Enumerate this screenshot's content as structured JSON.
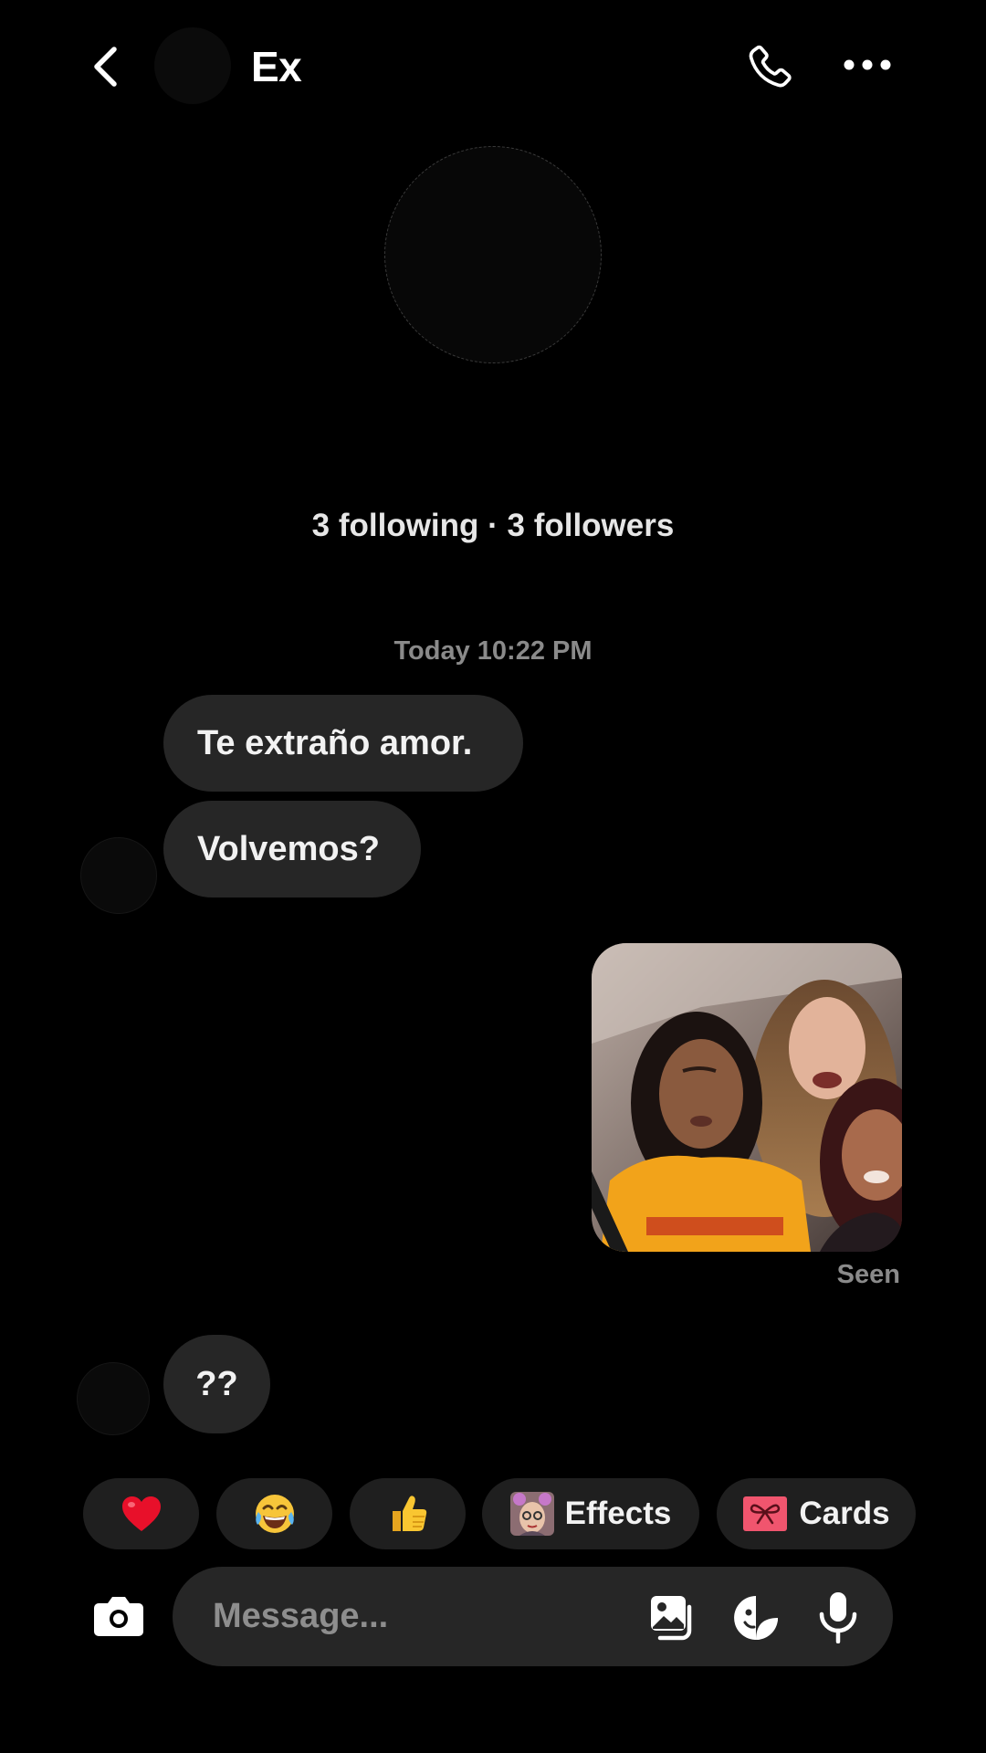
{
  "header": {
    "name": "Ex",
    "icons": {
      "back": "chevron-left-icon",
      "call": "phone-icon",
      "more": "more-horizontal-icon"
    }
  },
  "profile": {
    "stats": "3 following · 3 followers"
  },
  "thread": {
    "timestamp": "Today 10:22 PM",
    "messages": [
      {
        "from": "them",
        "text": "Te extraño amor."
      },
      {
        "from": "them",
        "text": "Volvemos?"
      },
      {
        "from": "me",
        "type": "image"
      },
      {
        "from": "them",
        "text": "??"
      }
    ],
    "seen_label": "Seen"
  },
  "quick_replies": {
    "heart": "❤️",
    "laugh": "😂",
    "thumbs_up": "👍",
    "effects_label": "Effects",
    "cards_label": "Cards"
  },
  "composer": {
    "placeholder": "Message...",
    "icons": {
      "camera": "camera-icon",
      "gallery": "gallery-icon",
      "sticker": "sticker-icon",
      "mic": "microphone-icon"
    }
  },
  "colors": {
    "background": "#000000",
    "bubble": "#262626",
    "chip": "#1f1f1f",
    "muted_text": "#8a8a8a",
    "heart": "#e8102a"
  }
}
